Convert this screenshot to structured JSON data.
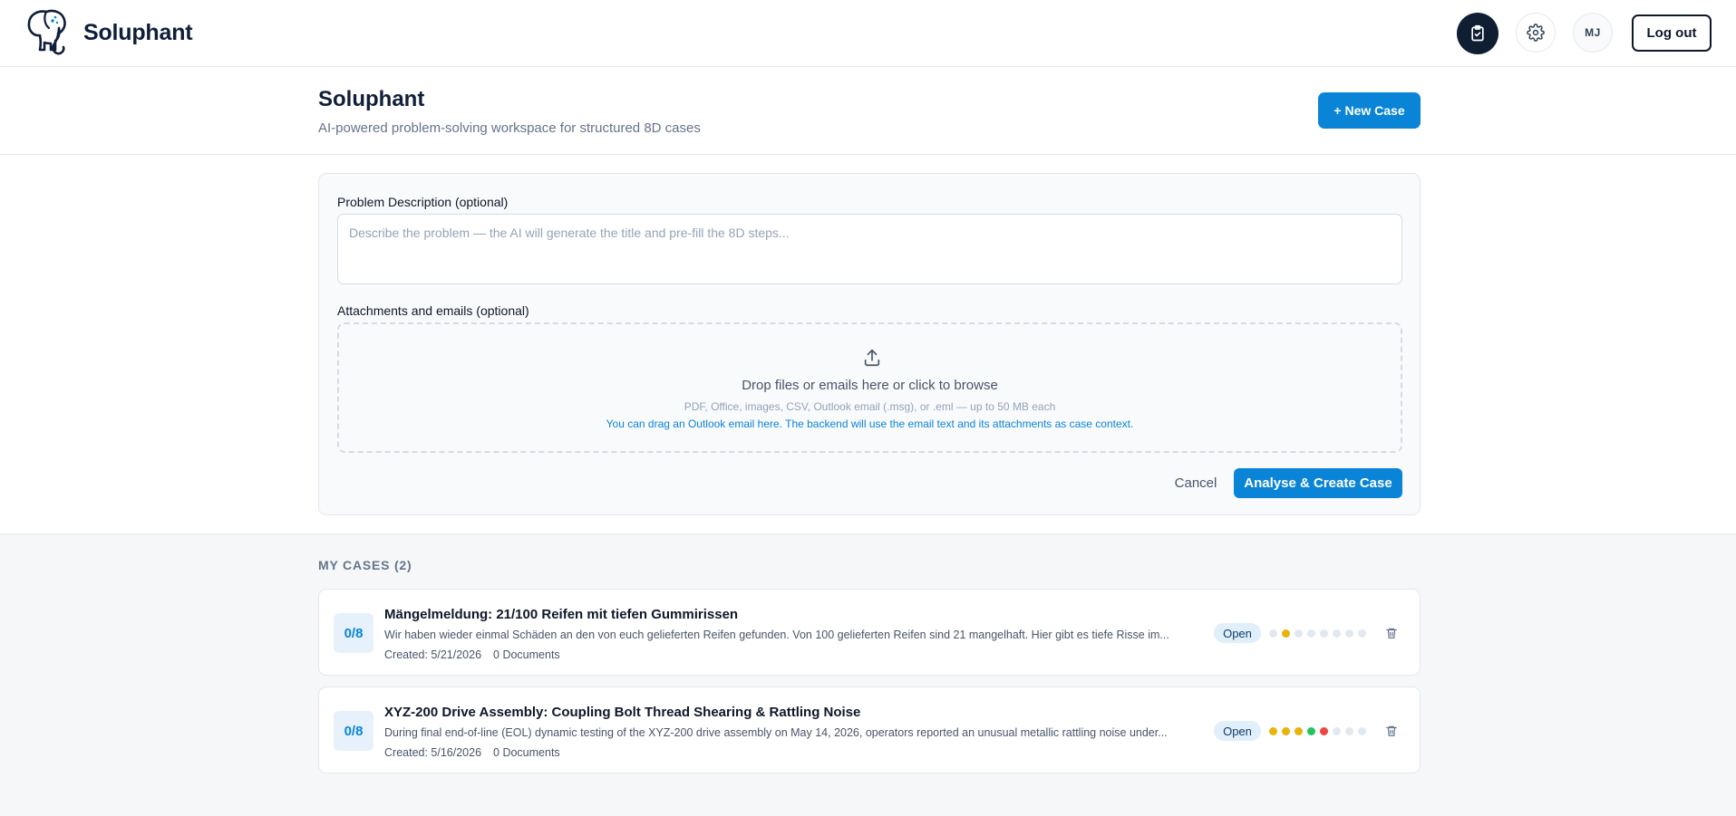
{
  "nav": {
    "brand": "Soluphant",
    "avatar_initials": "MJ",
    "logout_label": "Log out",
    "icons": [
      "elephant-logo-icon",
      "clipboard-check-icon",
      "gear-icon"
    ]
  },
  "header": {
    "title": "Soluphant",
    "subtitle": "AI-powered problem-solving workspace for structured 8D cases",
    "new_case_label": "+ New Case"
  },
  "form": {
    "problem_label": "Problem Description (optional)",
    "problem_placeholder": "Describe the problem — the AI will generate the title and pre-fill the 8D steps...",
    "problem_value": "",
    "attach_label": "Attachments and emails (optional)",
    "dropzone_main": "Drop files or emails here or click to browse",
    "dropzone_sub": "PDF, Office, images, CSV, Outlook email (.msg), or .eml — up to 50 MB each",
    "dropzone_hint": "You can drag an Outlook email here. The backend will use the email text and its attachments as case context.",
    "cancel_label": "Cancel",
    "submit_label": "Analyse & Create Case"
  },
  "cases": {
    "heading": "MY CASES (2)",
    "items": [
      {
        "progress": "0/8",
        "title": "Mängelmeldung: 21/100 Reifen mit tiefen Gummirissen",
        "description": "Wir haben wieder einmal Schäden an den von euch gelieferten Reifen gefunden. Von 100 gelieferten Reifen sind 21 mangelhaft. Hier gibt es tiefe Risse im...",
        "created": "Created: 5/21/2026",
        "documents": "0 Documents",
        "status": "Open",
        "step_colors": [
          "#e2e8f0",
          "#eab308",
          "#e2e8f0",
          "#e2e8f0",
          "#e2e8f0",
          "#e2e8f0",
          "#e2e8f0",
          "#e2e8f0"
        ]
      },
      {
        "progress": "0/8",
        "title": "XYZ-200 Drive Assembly: Coupling Bolt Thread Shearing & Rattling Noise",
        "description": "During final end-of-line (EOL) dynamic testing of the XYZ-200 drive assembly on May 14, 2026, operators reported an unusual metallic rattling noise under...",
        "created": "Created: 5/16/2026",
        "documents": "0 Documents",
        "status": "Open",
        "step_colors": [
          "#eab308",
          "#eab308",
          "#eab308",
          "#22c55e",
          "#ef4444",
          "#e2e8f0",
          "#e2e8f0",
          "#e2e8f0"
        ]
      }
    ]
  },
  "colors": {
    "accent": "#0a84d6",
    "nav_dark": "#0f1e33",
    "step_pending": "#e2e8f0",
    "step_in_progress": "#eab308",
    "step_done": "#22c55e",
    "step_issue": "#ef4444"
  }
}
